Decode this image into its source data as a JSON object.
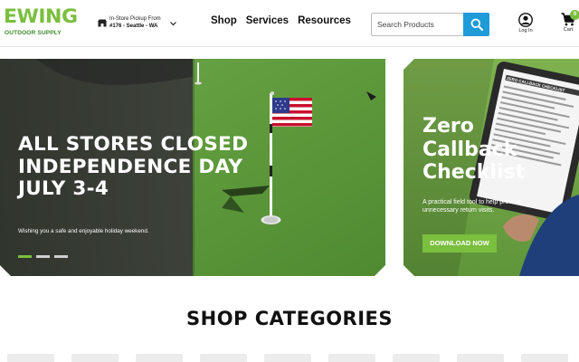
{
  "header": {
    "logo": {
      "word": "EWING",
      "sub": "OUTDOOR SUPPLY"
    },
    "store": {
      "line1": "In-Store Pickup From",
      "line2": "#176 - Seattle - WA"
    },
    "nav": [
      {
        "label": "Shop"
      },
      {
        "label": "Services"
      },
      {
        "label": "Resources"
      }
    ],
    "search": {
      "placeholder": "Search Products"
    },
    "login": {
      "label": "Log In"
    },
    "cart": {
      "label": "Cart",
      "count": "0"
    }
  },
  "hero": {
    "title": "ALL STORES CLOSED INDEPENDENCE DAY JULY 3-4",
    "subtitle": "Wishing you a safe and enjoyable holiday weekend.",
    "slides": 3,
    "active_slide": 1
  },
  "promo": {
    "title": "Zero Callback Checklist",
    "description": "A practical field tool to help prevent unnecessary return visits.",
    "button": "DOWNLOAD NOW",
    "tablet_heading": "ZERO CALLBACK CHECKLIST"
  },
  "categories": {
    "title": "SHOP CATEGORIES",
    "visible_items": 9
  },
  "colors": {
    "brand_green": "#7bbf3f",
    "search_blue": "#1f9bd7",
    "turf_green": "#5f9a3b"
  }
}
